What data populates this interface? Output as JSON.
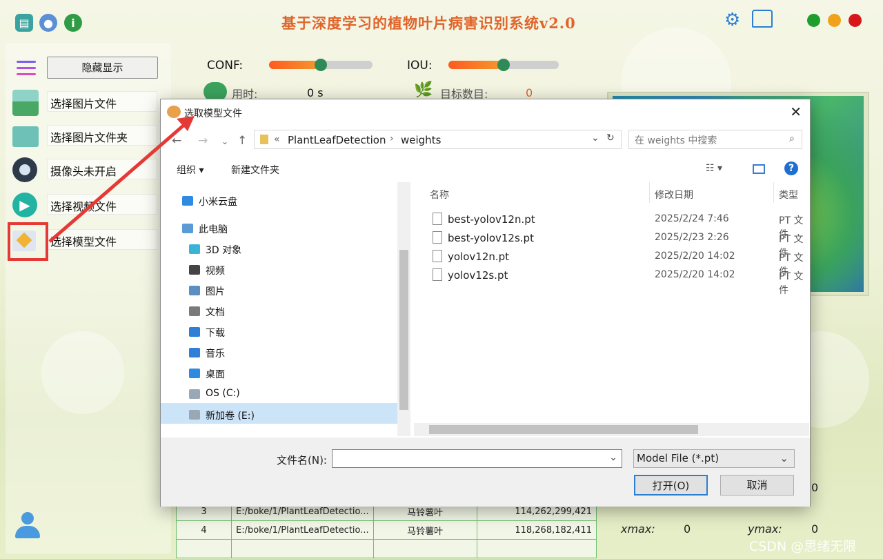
{
  "app": {
    "title": "基于深度学习的植物叶片病害识别系统v2.0",
    "hide_button": "隐藏显示",
    "menu": [
      {
        "label": "选择图片文件",
        "icon": "image-icon"
      },
      {
        "label": "选择图片文件夹",
        "icon": "folder-icon"
      },
      {
        "label": "摄像头未开启",
        "icon": "camera-icon"
      },
      {
        "label": "选择视频文件",
        "icon": "play-icon"
      },
      {
        "label": "选择模型文件",
        "icon": "model-icon"
      }
    ],
    "conf_label": "CONF:",
    "iou_label": "IOU:",
    "conf_value": 0.5,
    "iou_value": 0.5,
    "time_label": "用时:",
    "time_value": "0 s",
    "count_label": "目标数目:",
    "count_value": "0",
    "table_rows": [
      {
        "idx": "3",
        "path": "E:/boke/1/PlantLeafDetectio...",
        "cls": "马铃薯叶",
        "box": "114,262,299,421"
      },
      {
        "idx": "4",
        "path": "E:/boke/1/PlantLeafDetectio...",
        "cls": "马铃薯叶",
        "box": "118,268,182,411"
      }
    ],
    "xmax_label": "xmax:",
    "xmax_value": "0",
    "ymax_label": "ymax:",
    "ymax_value": "0",
    "side_value": "0",
    "watermark": "CSDN @思绪无限",
    "colors": {
      "title": "#e0642a",
      "accent_green": "#2e8b57",
      "annotation_red": "#e53935"
    }
  },
  "dialog": {
    "title": "选取模型文件",
    "breadcrumb": [
      "PlantLeafDetection",
      "weights"
    ],
    "breadcrumb_prefix": "«",
    "search_placeholder": "在 weights 中搜索",
    "organize": "组织",
    "new_folder": "新建文件夹",
    "nav": [
      {
        "label": "小米云盘",
        "icon": "cloud-icon"
      },
      {
        "label": "此电脑",
        "icon": "computer-icon"
      },
      {
        "label": "3D 对象",
        "icon": "cube-icon"
      },
      {
        "label": "视频",
        "icon": "video-icon"
      },
      {
        "label": "图片",
        "icon": "picture-icon"
      },
      {
        "label": "文档",
        "icon": "document-icon"
      },
      {
        "label": "下载",
        "icon": "download-icon"
      },
      {
        "label": "音乐",
        "icon": "music-icon"
      },
      {
        "label": "桌面",
        "icon": "desktop-icon"
      },
      {
        "label": "OS (C:)",
        "icon": "drive-icon"
      },
      {
        "label": "新加卷 (E:)",
        "icon": "drive-icon"
      }
    ],
    "columns": {
      "name": "名称",
      "date": "修改日期",
      "type": "类型"
    },
    "files": [
      {
        "name": "best-yolov12n.pt",
        "date": "2025/2/24 7:46",
        "type": "PT 文件"
      },
      {
        "name": "best-yolov12s.pt",
        "date": "2025/2/23 2:26",
        "type": "PT 文件"
      },
      {
        "name": "yolov12n.pt",
        "date": "2025/2/20 14:02",
        "type": "PT 文件"
      },
      {
        "name": "yolov12s.pt",
        "date": "2025/2/20 14:02",
        "type": "PT 文件"
      }
    ],
    "filename_label": "文件名(N):",
    "filename_value": "",
    "filter": "Model File (*.pt)",
    "open": "打开(O)",
    "cancel": "取消"
  }
}
